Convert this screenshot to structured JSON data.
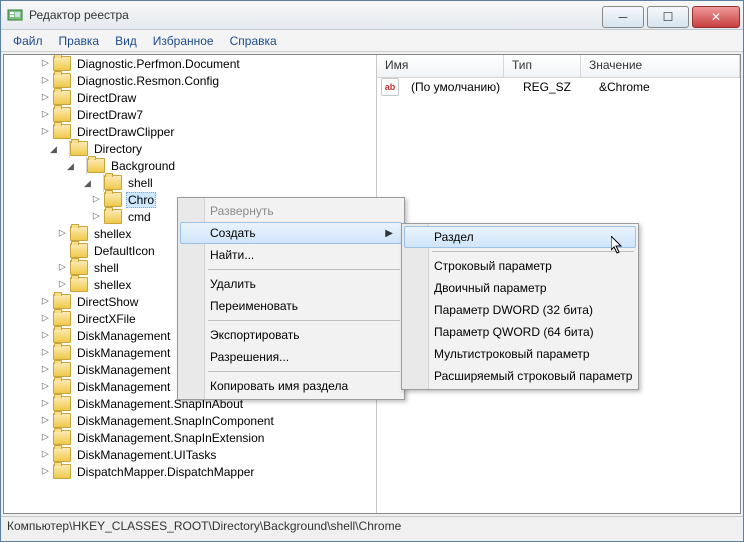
{
  "window": {
    "title": "Редактор реестра"
  },
  "menubar": [
    "Файл",
    "Правка",
    "Вид",
    "Избранное",
    "Справка"
  ],
  "tree": {
    "items": [
      {
        "depth": 2,
        "tw": "exp",
        "label": "Diagnostic.Perfmon.Document"
      },
      {
        "depth": 2,
        "tw": "exp",
        "label": "Diagnostic.Resmon.Config"
      },
      {
        "depth": 2,
        "tw": "exp",
        "label": "DirectDraw"
      },
      {
        "depth": 2,
        "tw": "exp",
        "label": "DirectDraw7"
      },
      {
        "depth": 2,
        "tw": "exp",
        "label": "DirectDrawClipper"
      },
      {
        "depth": 2,
        "tw": "col",
        "label": "Directory"
      },
      {
        "depth": 3,
        "tw": "col",
        "label": "Background"
      },
      {
        "depth": 4,
        "tw": "col",
        "label": "shell"
      },
      {
        "depth": 5,
        "tw": "exp",
        "label": "Chro",
        "selected": true
      },
      {
        "depth": 5,
        "tw": "exp",
        "label": "cmd"
      },
      {
        "depth": 3,
        "tw": "exp",
        "label": "shellex"
      },
      {
        "depth": 3,
        "tw": "",
        "label": "DefaultIcon"
      },
      {
        "depth": 3,
        "tw": "exp",
        "label": "shell"
      },
      {
        "depth": 3,
        "tw": "exp",
        "label": "shellex"
      },
      {
        "depth": 2,
        "tw": "exp",
        "label": "DirectShow"
      },
      {
        "depth": 2,
        "tw": "exp",
        "label": "DirectXFile"
      },
      {
        "depth": 2,
        "tw": "exp",
        "label": "DiskManagement"
      },
      {
        "depth": 2,
        "tw": "exp",
        "label": "DiskManagement"
      },
      {
        "depth": 2,
        "tw": "exp",
        "label": "DiskManagement"
      },
      {
        "depth": 2,
        "tw": "exp",
        "label": "DiskManagement"
      },
      {
        "depth": 2,
        "tw": "exp",
        "label": "DiskManagement.SnapInAbout"
      },
      {
        "depth": 2,
        "tw": "exp",
        "label": "DiskManagement.SnapInComponent"
      },
      {
        "depth": 2,
        "tw": "exp",
        "label": "DiskManagement.SnapInExtension"
      },
      {
        "depth": 2,
        "tw": "exp",
        "label": "DiskManagement.UITasks"
      },
      {
        "depth": 2,
        "tw": "exp",
        "label": "DispatchMapper.DispatchMapper"
      }
    ]
  },
  "columns": {
    "name": "Имя",
    "type": "Тип",
    "value": "Значение"
  },
  "values": [
    {
      "name": "(По умолчанию)",
      "type": "REG_SZ",
      "value": "&Chrome"
    }
  ],
  "ctx1": {
    "items": [
      {
        "label": "Развернуть",
        "disabled": true
      },
      {
        "label": "Создать",
        "submenu": true,
        "hover": true
      },
      {
        "label": "Найти..."
      },
      {
        "sep": true
      },
      {
        "label": "Удалить"
      },
      {
        "label": "Переименовать"
      },
      {
        "sep": true
      },
      {
        "label": "Экспортировать"
      },
      {
        "label": "Разрешения..."
      },
      {
        "sep": true
      },
      {
        "label": "Копировать имя раздела"
      }
    ]
  },
  "ctx2": {
    "items": [
      {
        "label": "Раздел",
        "hover": true
      },
      {
        "sep": true
      },
      {
        "label": "Строковый параметр"
      },
      {
        "label": "Двоичный параметр"
      },
      {
        "label": "Параметр DWORD (32 бита)"
      },
      {
        "label": "Параметр QWORD (64 бита)"
      },
      {
        "label": "Мультистроковый параметр"
      },
      {
        "label": "Расширяемый строковый параметр"
      }
    ]
  },
  "statusbar": "Компьютер\\HKEY_CLASSES_ROOT\\Directory\\Background\\shell\\Chrome"
}
